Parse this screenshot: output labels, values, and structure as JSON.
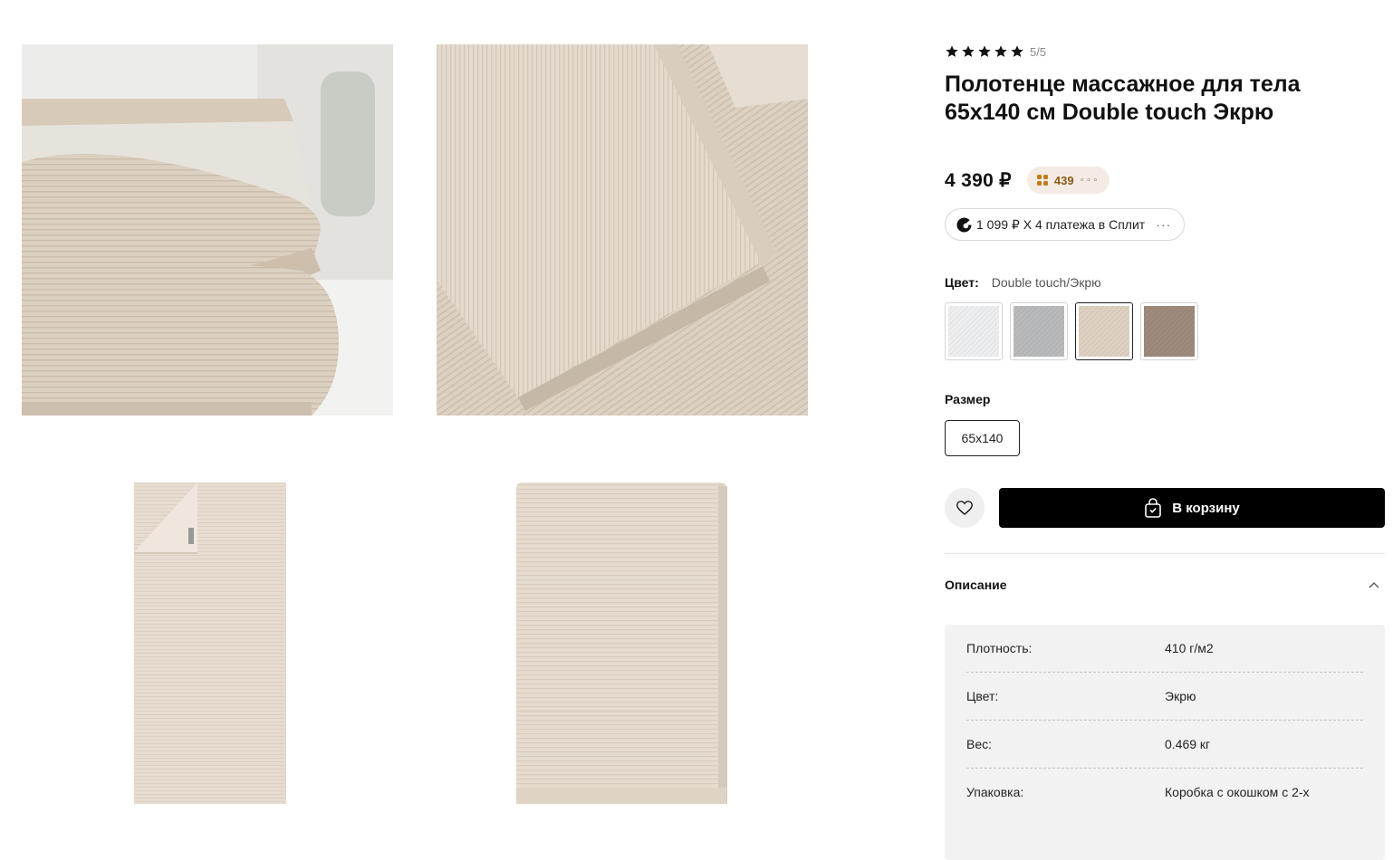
{
  "product": {
    "rating": {
      "stars": 5,
      "text": "5/5"
    },
    "title": "Полотенце массажное для тела 65x140 см Double touch Экрю",
    "price": "4 390 ₽",
    "bonus": {
      "value": "439",
      "more": "∘∘∘"
    },
    "split": {
      "text": "1 099 ₽ X 4 платежа в Сплит",
      "more": "···"
    },
    "color": {
      "label": "Цвет:",
      "value": "Double touch/Экрю",
      "swatches": [
        {
          "name": "white",
          "color": "#eceef0",
          "selected": false
        },
        {
          "name": "grey",
          "color": "#b9babb",
          "selected": false
        },
        {
          "name": "ecru",
          "color": "#dfd1c1",
          "selected": true
        },
        {
          "name": "brown",
          "color": "#9e8a7c",
          "selected": false
        }
      ]
    },
    "size": {
      "label": "Размер",
      "value": "65x140"
    },
    "cart_label": "В корзину",
    "description": {
      "title": "Описание",
      "specs": [
        {
          "key": "Плотность:",
          "value": "410 г/м2"
        },
        {
          "key": "Цвет:",
          "value": "Экрю"
        },
        {
          "key": "Вес:",
          "value": "0.469 кг"
        },
        {
          "key": "Упаковка:",
          "value": "Коробка с окошком с 2-х"
        }
      ]
    }
  },
  "colors": {
    "towel": "#e2d6c8",
    "towel_shadow": "#cbbdad",
    "accent_bonus": "#8b5a16"
  }
}
